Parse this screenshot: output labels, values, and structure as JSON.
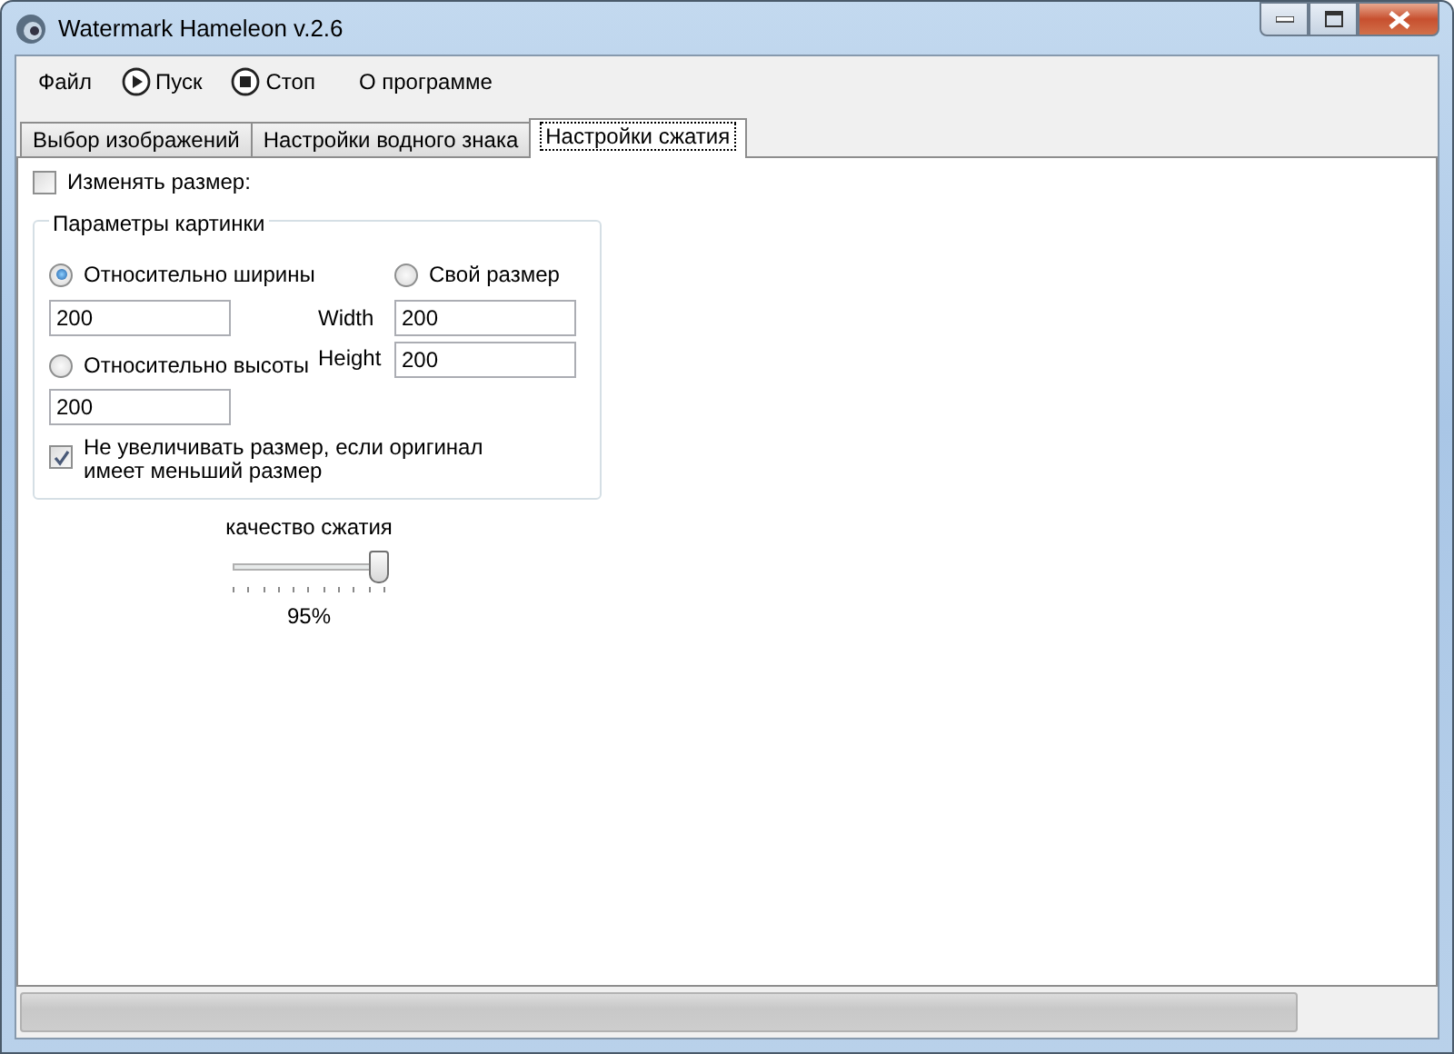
{
  "window": {
    "title": "Watermark Hameleon v.2.6"
  },
  "menu": [
    {
      "label": "Файл",
      "kind": "plain"
    },
    {
      "label": "Пуск",
      "kind": "play"
    },
    {
      "label": "Стоп",
      "kind": "stop"
    },
    {
      "label": "О программе",
      "kind": "plain"
    }
  ],
  "tabs": [
    {
      "label": "Выбор изображений",
      "selected": false
    },
    {
      "label": "Настройки водного знака",
      "selected": false
    },
    {
      "label": "Настройки сжатия",
      "selected": true
    }
  ],
  "resize": {
    "label": "Изменять размер:",
    "checked": false
  },
  "group": {
    "title": "Параметры картинки",
    "by_width": {
      "label": "Относительно ширины",
      "selected": true,
      "value": "200"
    },
    "by_height": {
      "label": "Относительно высоты",
      "selected": false,
      "value": "200"
    },
    "custom": {
      "label": "Свой размер",
      "selected": false,
      "width_label": "Width",
      "width_value": "200",
      "height_label": "Height",
      "height_value": "200"
    },
    "no_upscale": {
      "label": "Не увеличивать размер, если оригинал имеет меньший размер",
      "checked": true
    }
  },
  "quality": {
    "label": "качество сжатия",
    "level": 0.95,
    "reading": "95%"
  },
  "status_bar": {
    "progress": {
      "level": 0.0
    }
  }
}
